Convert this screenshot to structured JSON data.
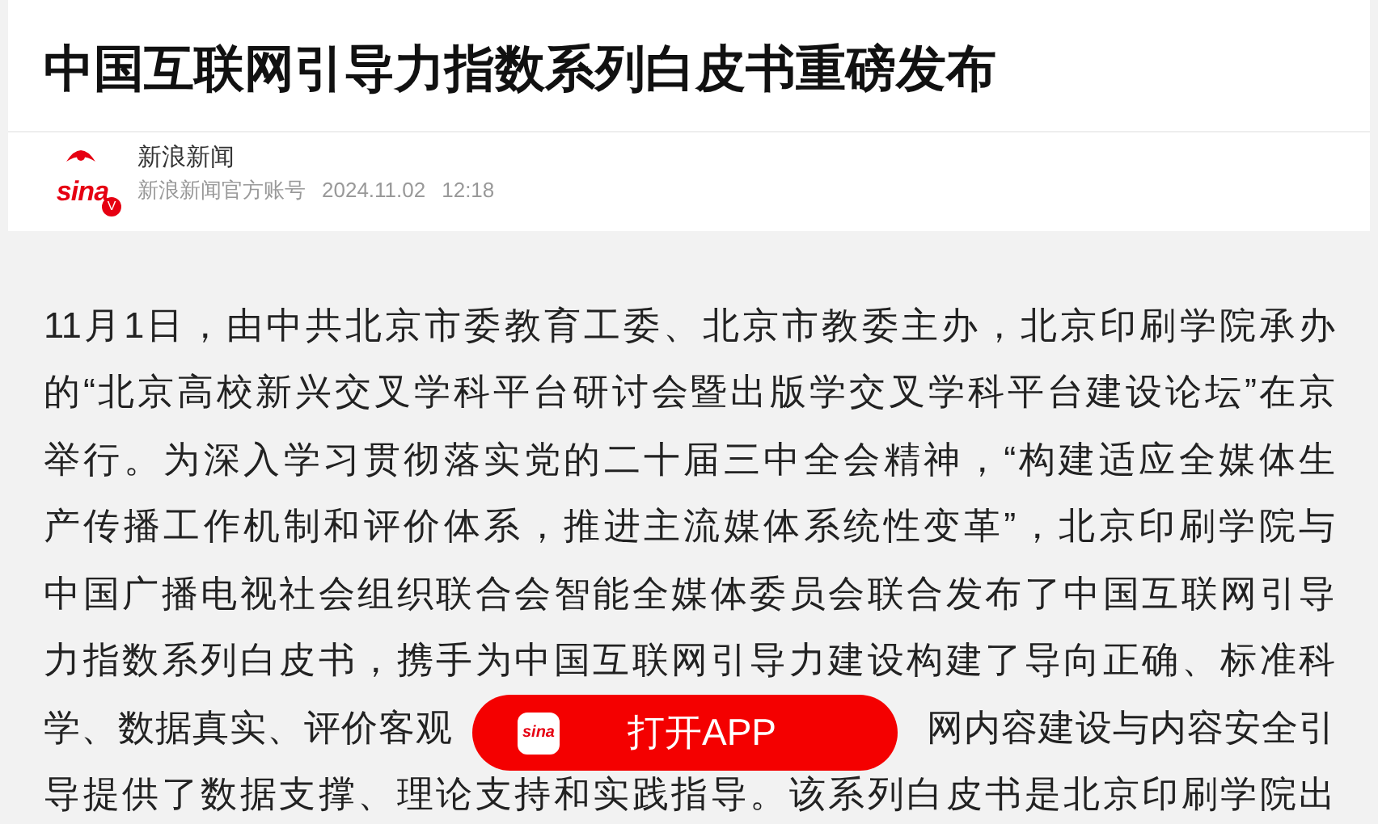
{
  "article": {
    "title": "中国互联网引导力指数系列白皮书重磅发布"
  },
  "author": {
    "logo_text": "sina",
    "badge": "V",
    "name": "新浪新闻",
    "account": "新浪新闻官方账号",
    "date": "2024.11.02",
    "time": "12:18"
  },
  "body_lines": [
    {
      "segments": [
        "11月1日，由中共北京市委教育工委、北京市教委主办，北京印刷学院承办"
      ]
    },
    {
      "segments": [
        "的“北京高校新兴交叉学科平台研讨会暨出版学交叉学科平台建设论坛”在京"
      ]
    },
    {
      "segments": [
        "举行。为深入学习贯彻落实党的二十届三中全会精神，“构建适应全媒体生"
      ]
    },
    {
      "segments": [
        "产传播工作机制和评价体系，推进主流媒体系统性变革”，北京印刷学院与"
      ]
    },
    {
      "segments": [
        "中国广播电视社会组织联合会智能全媒体委员会联合发布了中国互联网引导"
      ]
    },
    {
      "segments": [
        "力指数系列白皮书，携手为中国互联网引导力建设构建了导向正确、标准科"
      ]
    },
    {
      "segments": [
        "学、数据真实、评价客观",
        "网内容建设与内容安全引"
      ]
    },
    {
      "segments": [
        "导提供了数据支撑、理论支持和实践指导。该系列白皮书是北京印刷学院出"
      ]
    }
  ],
  "open_app_button": {
    "logo_text": "sina",
    "label": "打开APP"
  }
}
